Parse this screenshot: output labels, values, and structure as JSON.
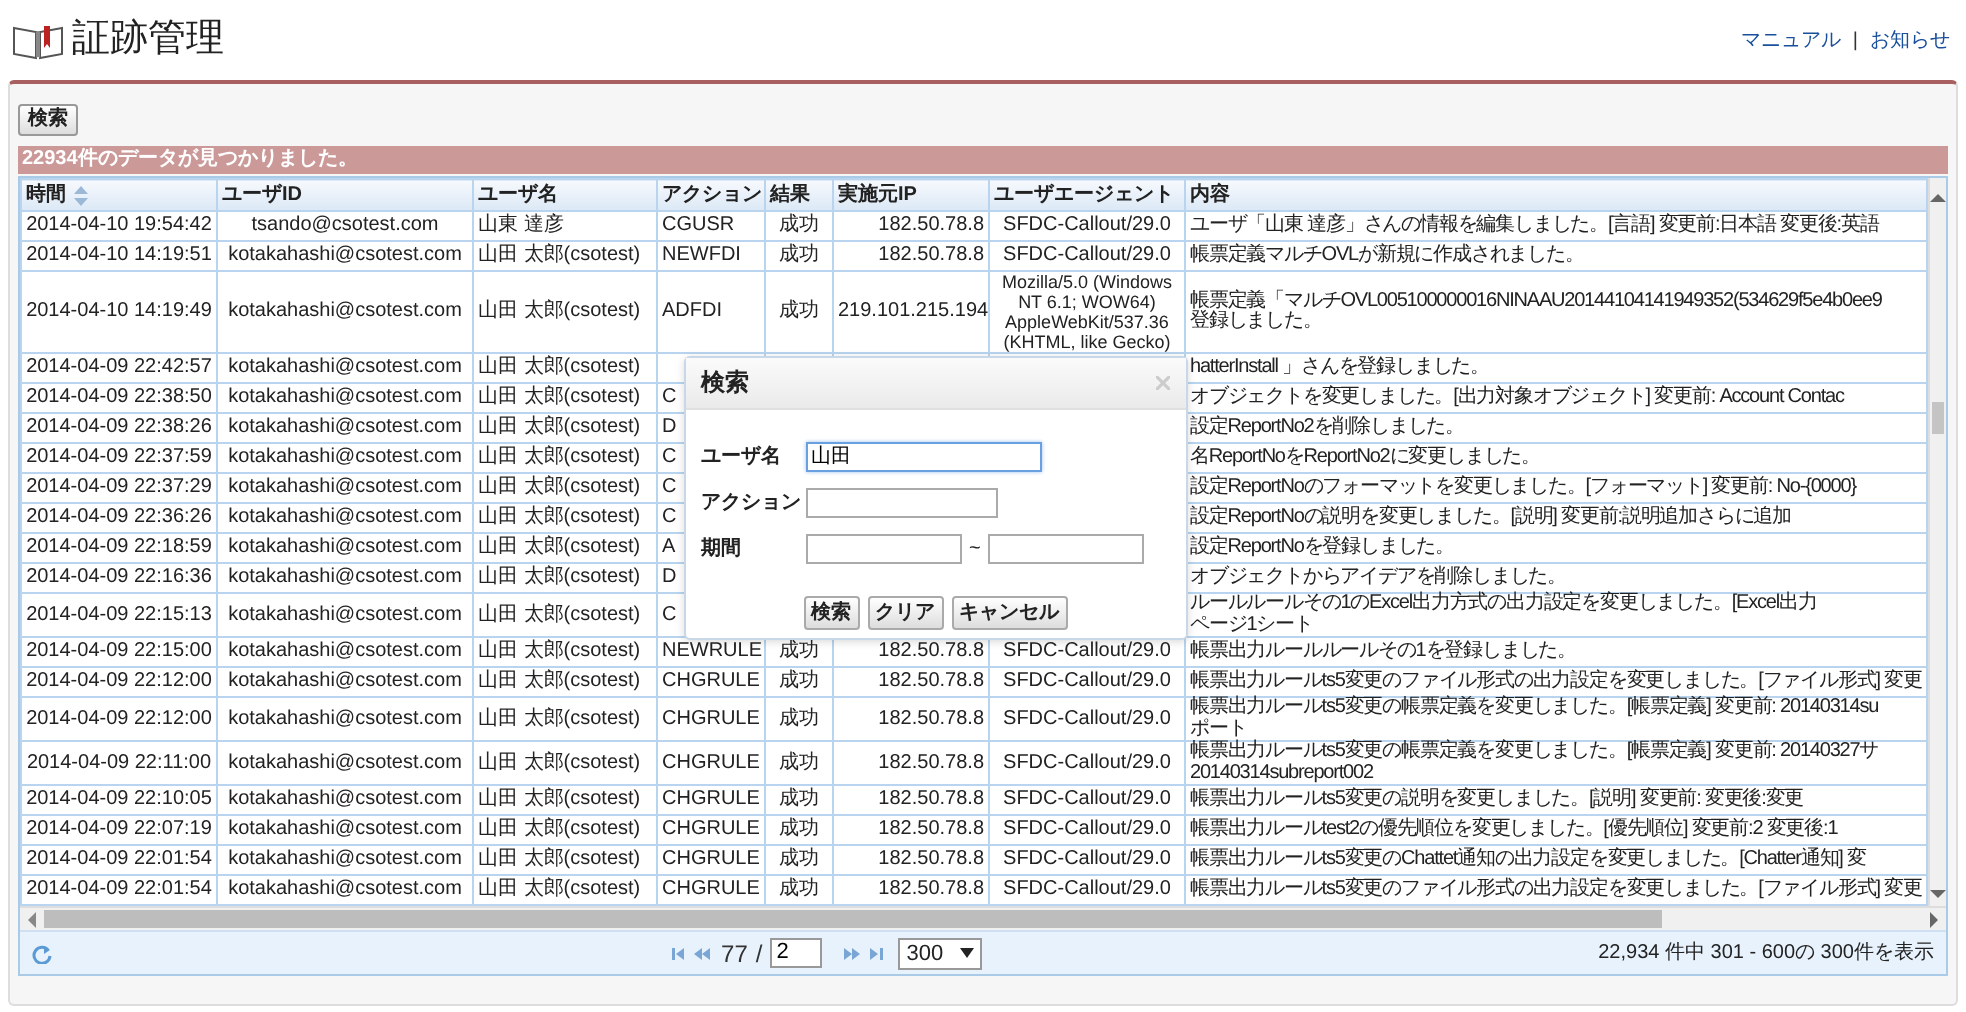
{
  "header": {
    "title": "証跡管理",
    "links": [
      "マニュアル",
      "お知らせ"
    ],
    "separator": "|"
  },
  "search_button": "検索",
  "result_banner": "22934件のデータが見つかりました。",
  "table": {
    "columns": [
      {
        "label": "時間",
        "sorted": true
      },
      {
        "label": "ユーザID",
        "sorted": false
      },
      {
        "label": "ユーザ名",
        "sorted": false
      },
      {
        "label": "アクション",
        "sorted": false
      },
      {
        "label": "結果",
        "sorted": false
      },
      {
        "label": "実施元IP",
        "sorted": false
      },
      {
        "label": "ユーザエージェント",
        "sorted": false
      },
      {
        "label": "内容",
        "sorted": false
      }
    ],
    "rows": [
      {
        "time": "2014-04-10 19:54:42",
        "user_id": "tsando@csotest.com",
        "user_name": "山東 達彦",
        "action": "CGUSR",
        "result": "成功",
        "source_ip": "182.50.78.8",
        "user_agent": "SFDC-Callout/29.0",
        "content": "ユーザ「山東 達彦」さんの情報を編集しました。[言語] 変更前:日本語 変更後:英語"
      },
      {
        "time": "2014-04-10 14:19:51",
        "user_id": "kotakahashi@csotest.com",
        "user_name": "山田 太郎(csotest)",
        "action": "NEWFDI",
        "result": "成功",
        "source_ip": "182.50.78.8",
        "user_agent": "SFDC-Callout/29.0",
        "content": "帳票定義マルチOVLが新規に作成されました。"
      },
      {
        "time": "2014-04-10 14:19:49",
        "user_id": "kotakahashi@csotest.com",
        "user_name": "山田 太郎(csotest)",
        "action": "ADFDI",
        "result": "成功",
        "source_ip": "219.101.215.194",
        "user_agent": "Mozilla/5.0 (Windows NT 6.1; WOW64) AppleWebKit/537.36 (KHTML, like Gecko)",
        "content": [
          "帳票定義「マルチOVL005100000016NINAAU20144104141949352(534629f5e4b0ee9",
          "登録しました。"
        ]
      },
      {
        "time": "2014-04-09 22:42:57",
        "user_id": "kotakahashi@csotest.com",
        "user_name": "山田 太郎(csotest)",
        "content": "hatterInstall 」さんを登録しました。"
      },
      {
        "time": "2014-04-09 22:38:50",
        "user_id": "kotakahashi@csotest.com",
        "user_name": "山田 太郎(csotest)",
        "action": "C",
        "content": "オブジェクトを変更しました。[出力対象オブジェクト] 変更前: Account Contac"
      },
      {
        "time": "2014-04-09 22:38:26",
        "user_id": "kotakahashi@csotest.com",
        "user_name": "山田 太郎(csotest)",
        "action": "D",
        "content": "設定ReportNo2を削除しました。"
      },
      {
        "time": "2014-04-09 22:37:59",
        "user_id": "kotakahashi@csotest.com",
        "user_name": "山田 太郎(csotest)",
        "action": "C",
        "content": "名ReportNoをReportNo2に変更しました。"
      },
      {
        "time": "2014-04-09 22:37:29",
        "user_id": "kotakahashi@csotest.com",
        "user_name": "山田 太郎(csotest)",
        "action": "C",
        "content": "設定ReportNoのフォーマットを変更しました。[フォーマット] 変更前: No-{0000}"
      },
      {
        "time": "2014-04-09 22:36:26",
        "user_id": "kotakahashi@csotest.com",
        "user_name": "山田 太郎(csotest)",
        "action": "C",
        "content": "設定ReportNoの説明を変更しました。[説明] 変更前:説明追加さらに追加"
      },
      {
        "time": "2014-04-09 22:18:59",
        "user_id": "kotakahashi@csotest.com",
        "user_name": "山田 太郎(csotest)",
        "action": "A",
        "content": "設定ReportNoを登録しました。"
      },
      {
        "time": "2014-04-09 22:16:36",
        "user_id": "kotakahashi@csotest.com",
        "user_name": "山田 太郎(csotest)",
        "action": "D",
        "content": "オブジェクトからアイデアを削除しました。"
      },
      {
        "time": "2014-04-09 22:15:13",
        "user_id": "kotakahashi@csotest.com",
        "user_name": "山田 太郎(csotest)",
        "action": "C",
        "content": [
          "ルールルールその1のExcel出力方式の出力設定を変更しました。[Excel出力",
          "ページ1シート"
        ]
      },
      {
        "time": "2014-04-09 22:15:00",
        "user_id": "kotakahashi@csotest.com",
        "user_name": "山田 太郎(csotest)",
        "action": "NEWRULE",
        "result": "成功",
        "source_ip": "182.50.78.8",
        "user_agent": "SFDC-Callout/29.0",
        "content": "帳票出力ルールルールその1を登録しました。"
      },
      {
        "time": "2014-04-09 22:12:00",
        "user_id": "kotakahashi@csotest.com",
        "user_name": "山田 太郎(csotest)",
        "action": "CHGRULE",
        "result": "成功",
        "source_ip": "182.50.78.8",
        "user_agent": "SFDC-Callout/29.0",
        "content": "帳票出力ルールts5変更のファイル形式の出力設定を変更しました。[ファイル形式] 変更"
      },
      {
        "time": "2014-04-09 22:12:00",
        "user_id": "kotakahashi@csotest.com",
        "user_name": "山田 太郎(csotest)",
        "action": "CHGRULE",
        "result": "成功",
        "source_ip": "182.50.78.8",
        "user_agent": "SFDC-Callout/29.0",
        "content": [
          "帳票出力ルールts5変更の帳票定義を変更しました。[帳票定義] 変更前: 20140314su",
          "ポート"
        ]
      },
      {
        "time": "2014-04-09 22:11:00",
        "user_id": "kotakahashi@csotest.com",
        "user_name": "山田 太郎(csotest)",
        "action": "CHGRULE",
        "result": "成功",
        "source_ip": "182.50.78.8",
        "user_agent": "SFDC-Callout/29.0",
        "content": [
          "帳票出力ルールts5変更の帳票定義を変更しました。[帳票定義] 変更前: 20140327サ",
          "20140314subreport002"
        ]
      },
      {
        "time": "2014-04-09 22:10:05",
        "user_id": "kotakahashi@csotest.com",
        "user_name": "山田 太郎(csotest)",
        "action": "CHGRULE",
        "result": "成功",
        "source_ip": "182.50.78.8",
        "user_agent": "SFDC-Callout/29.0",
        "content": "帳票出力ルールts5変更の説明を変更しました。[説明] 変更前: 変更後:変更"
      },
      {
        "time": "2014-04-09 22:07:19",
        "user_id": "kotakahashi@csotest.com",
        "user_name": "山田 太郎(csotest)",
        "action": "CHGRULE",
        "result": "成功",
        "source_ip": "182.50.78.8",
        "user_agent": "SFDC-Callout/29.0",
        "content": "帳票出力ルールtest2の優先順位を変更しました。[優先順位] 変更前:2 変更後:1"
      },
      {
        "time": "2014-04-09 22:01:54",
        "user_id": "kotakahashi@csotest.com",
        "user_name": "山田 太郎(csotest)",
        "action": "CHGRULE",
        "result": "成功",
        "source_ip": "182.50.78.8",
        "user_agent": "SFDC-Callout/29.0",
        "content": "帳票出力ルールts5変更のChattet通知の出力設定を変更しました。[Chatter通知] 変"
      },
      {
        "time": "2014-04-09 22:01:54",
        "user_id": "kotakahashi@csotest.com",
        "user_name": "山田 太郎(csotest)",
        "action": "CHGRULE",
        "result": "成功",
        "source_ip": "182.50.78.8",
        "user_agent": "SFDC-Callout/29.0",
        "content": "帳票出力ルールts5変更のファイル形式の出力設定を変更しました。[ファイル形式] 変更"
      }
    ]
  },
  "pager": {
    "page": "77",
    "separator": "/",
    "page_input": "2",
    "page_size": "300",
    "summary": "22,934 件中 301 - 600の 300件を表示"
  },
  "dialog": {
    "title": "検索",
    "fields": [
      {
        "label": "ユーザ名",
        "kind": "text",
        "value": "山田",
        "focused": true
      },
      {
        "label": "アクション",
        "kind": "text",
        "focused": false
      },
      {
        "label": "期間",
        "kind": "range",
        "separator": "~",
        "focused": false
      }
    ],
    "buttons": [
      "検索",
      "クリア",
      "キャンセル"
    ]
  }
}
